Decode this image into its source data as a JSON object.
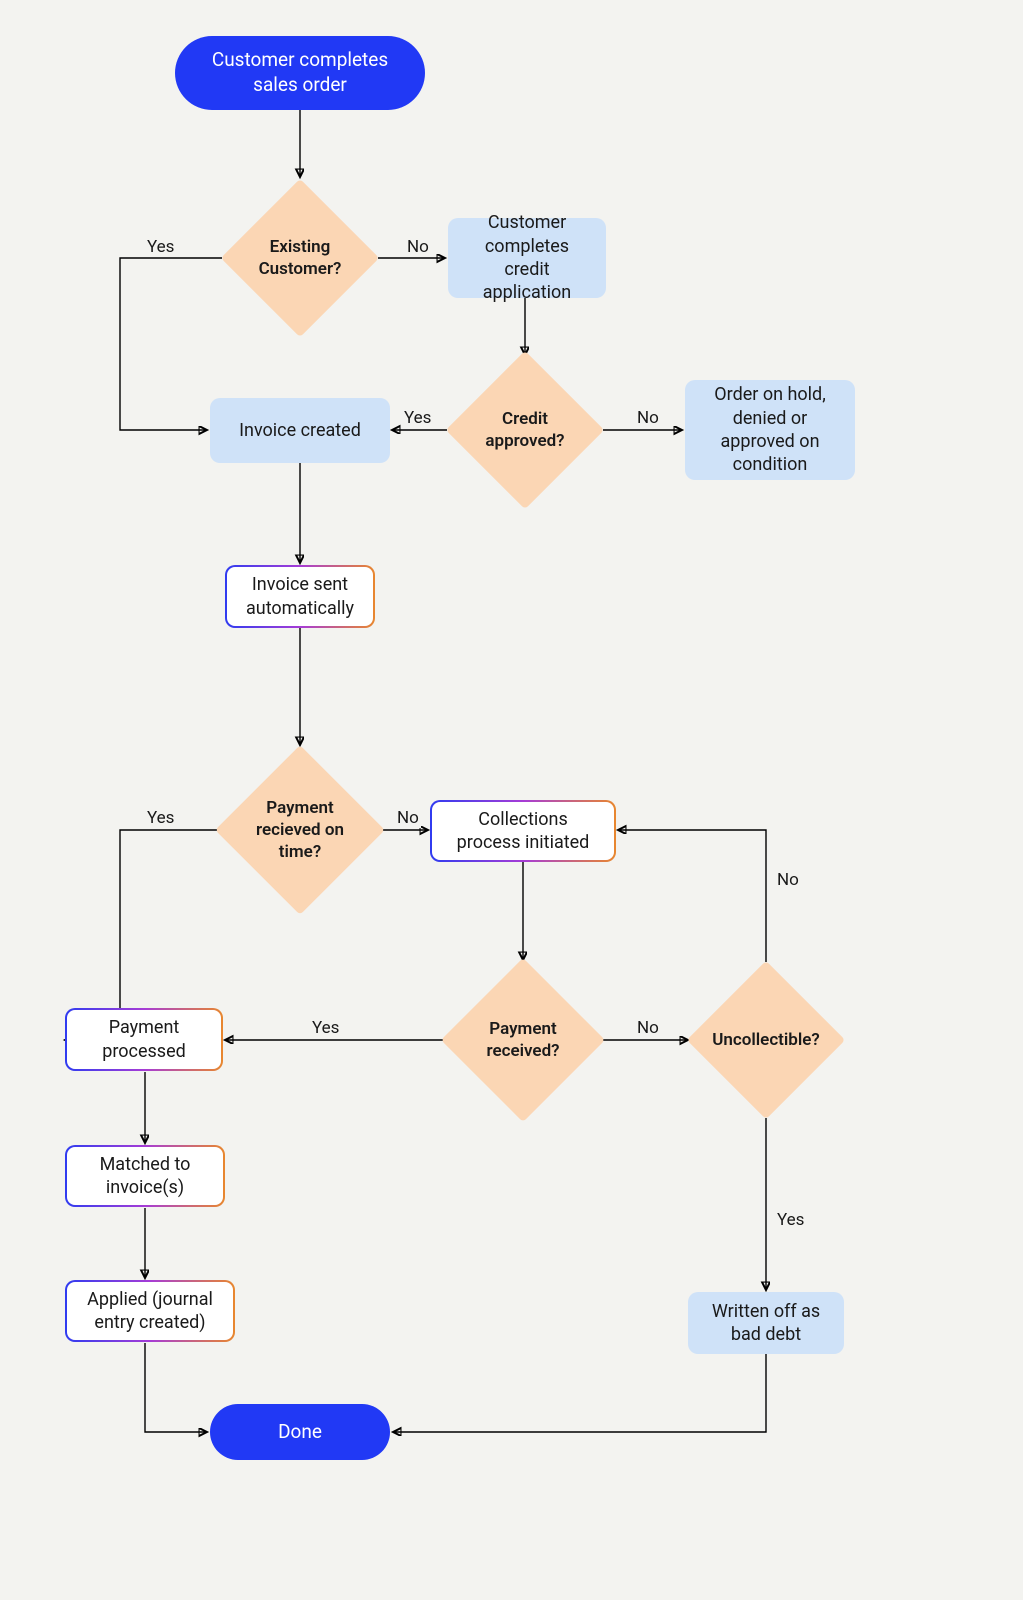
{
  "nodes": {
    "start": "Customer completes sales order",
    "existing": "Existing Customer?",
    "creditApp": "Customer completes credit application",
    "creditApproved": "Credit approved?",
    "orderHold": "Order on hold, denied or approved on condition",
    "invoiceCreated": "Invoice created",
    "invoiceSent": "Invoice sent automatically",
    "paymentOnTime": "Payment recieved on time?",
    "collections": "Collections process initiated",
    "paymentProcessed": "Payment processed",
    "paymentReceived": "Payment received?",
    "uncollectible": "Uncollectible?",
    "matched": "Matched to invoice(s)",
    "applied": "Applied (journal entry created)",
    "writtenOff": "Written off as bad debt",
    "done": "Done"
  },
  "labels": {
    "yes": "Yes",
    "no": "No"
  }
}
